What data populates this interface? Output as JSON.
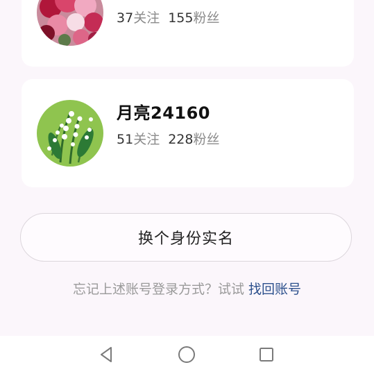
{
  "accounts": [
    {
      "name": "",
      "following_count": "37",
      "following_label": "关注",
      "followers_count": "155",
      "followers_label": "粉丝",
      "avatar_icon": "pink-flowers-avatar"
    },
    {
      "name": "月亮24160",
      "following_count": "51",
      "following_label": "关注",
      "followers_count": "228",
      "followers_label": "粉丝",
      "avatar_icon": "lily-of-the-valley-avatar"
    }
  ],
  "switch_button_label": "换个身份实名",
  "hint": {
    "text": "忘记上述账号登录方式？试试",
    "link": "找回账号"
  },
  "navbar": {
    "back_icon": "back-triangle-icon",
    "home_icon": "home-circle-icon",
    "recent_icon": "recent-square-icon"
  },
  "colors": {
    "background": "#fbf6fb",
    "link": "#2b4f8c",
    "avatar_green": "#8fc44f"
  }
}
